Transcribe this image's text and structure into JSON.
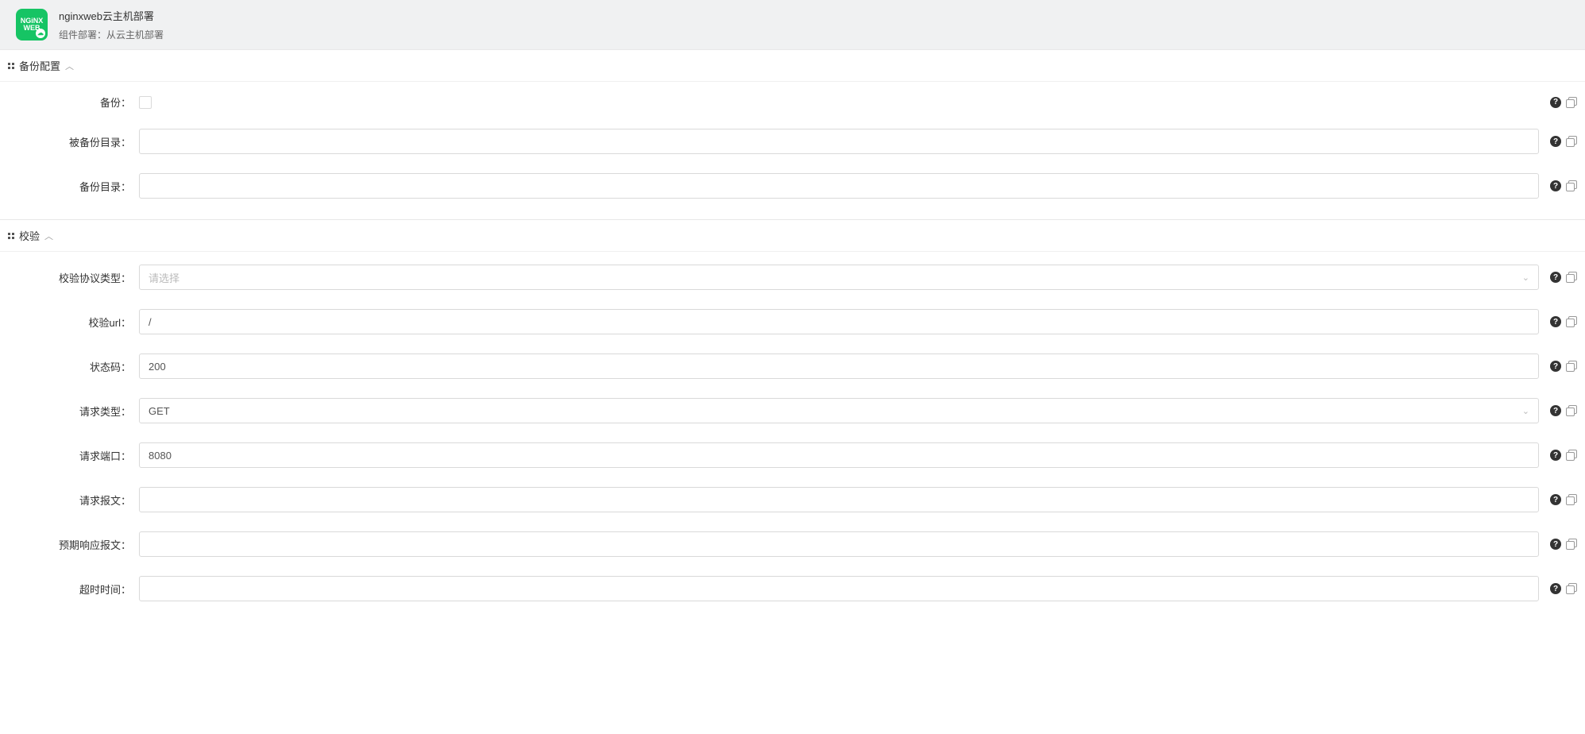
{
  "header": {
    "icon_text_1": "NGiNX",
    "icon_text_2": "WEB",
    "title": "nginxweb云主机部署",
    "subtitle": "组件部署：从云主机部署"
  },
  "sections": {
    "backup": {
      "title": "备份配置",
      "fields": {
        "enable": {
          "label": "备份："
        },
        "backed_dir": {
          "label": "被备份目录：",
          "value": ""
        },
        "backup_dir": {
          "label": "备份目录：",
          "value": ""
        }
      }
    },
    "check": {
      "title": "校验",
      "fields": {
        "protocol_type": {
          "label": "校验协议类型：",
          "placeholder": "请选择",
          "value": ""
        },
        "check_url": {
          "label": "校验url：",
          "value": "/"
        },
        "status_code": {
          "label": "状态码：",
          "value": "200"
        },
        "request_type": {
          "label": "请求类型：",
          "value": "GET"
        },
        "request_port": {
          "label": "请求端口：",
          "value": "8080"
        },
        "request_body": {
          "label": "请求报文：",
          "value": ""
        },
        "expected_response": {
          "label": "预期响应报文：",
          "value": ""
        },
        "timeout": {
          "label": "超时时间：",
          "value": ""
        }
      }
    }
  }
}
